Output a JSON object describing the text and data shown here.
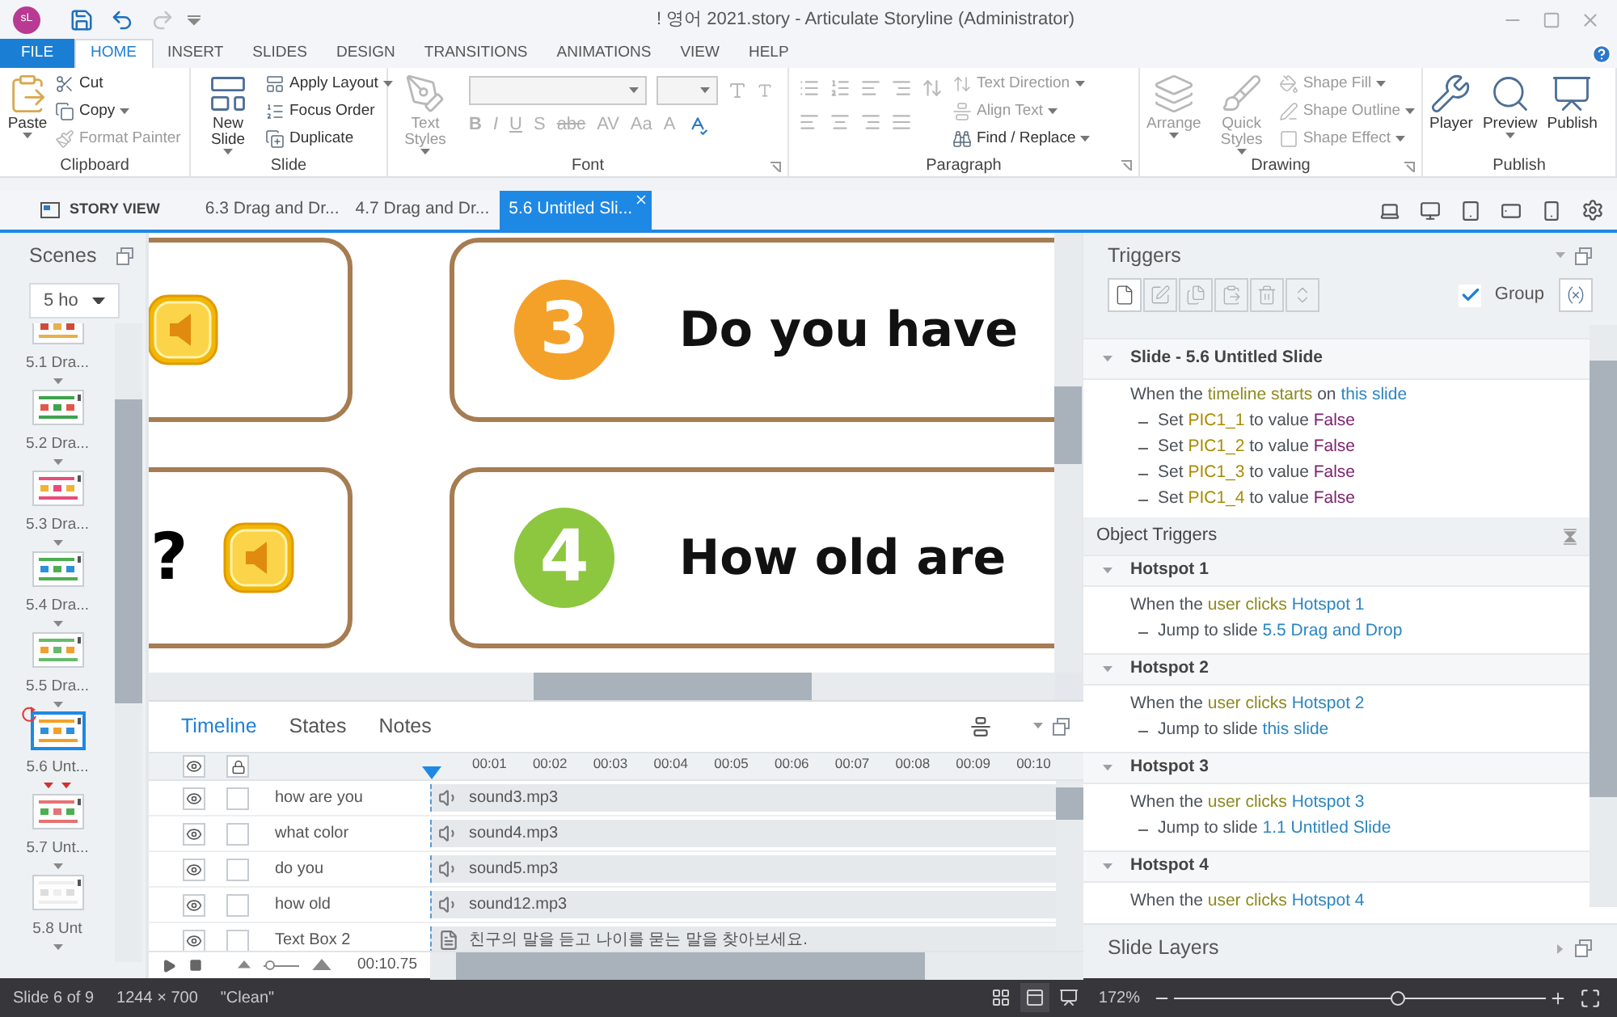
{
  "window": {
    "title": "! 영어 2021.story - Articulate Storyline (Administrator)",
    "app_badge": "sL"
  },
  "ribbon": {
    "tabs": [
      {
        "label": "FILE",
        "kind": "file",
        "selected": false
      },
      {
        "label": "HOME",
        "kind": "tab",
        "selected": true
      },
      {
        "label": "INSERT",
        "kind": "tab",
        "selected": false
      },
      {
        "label": "SLIDES",
        "kind": "tab",
        "selected": false
      },
      {
        "label": "DESIGN",
        "kind": "tab",
        "selected": false
      },
      {
        "label": "TRANSITIONS",
        "kind": "tab",
        "selected": false
      },
      {
        "label": "ANIMATIONS",
        "kind": "tab",
        "selected": false
      },
      {
        "label": "VIEW",
        "kind": "tab",
        "selected": false
      },
      {
        "label": "HELP",
        "kind": "tab",
        "selected": false
      }
    ],
    "groups": [
      {
        "kind": "clipboard",
        "label": "Clipboard",
        "launcher": false,
        "large": [
          {
            "label": "Paste",
            "dropdown": true,
            "disabled": false
          }
        ],
        "small": [
          {
            "label": "Cut",
            "dropdown": false,
            "disabled": false
          },
          {
            "label": "Copy",
            "dropdown": true,
            "disabled": false
          },
          {
            "label": "Format Painter",
            "dropdown": false,
            "disabled": true
          }
        ]
      },
      {
        "kind": "slide",
        "label": "Slide",
        "launcher": false,
        "large": [
          {
            "label": "New Slide",
            "dropdown": true,
            "disabled": false
          }
        ],
        "small": [
          {
            "label": "Apply Layout",
            "dropdown": true,
            "disabled": false
          },
          {
            "label": "Focus Order",
            "dropdown": false,
            "disabled": false
          },
          {
            "label": "Duplicate",
            "dropdown": false,
            "disabled": false
          }
        ]
      },
      {
        "kind": "font",
        "label": "Font",
        "launcher": true,
        "large": [
          {
            "label": "Text Styles",
            "dropdown": true,
            "disabled": true
          }
        ],
        "format_buttons": [
          "B",
          "I",
          "U",
          "S",
          "abc",
          "AV",
          "Aa",
          "A"
        ]
      },
      {
        "kind": "paragraph",
        "label": "Paragraph",
        "launcher": true,
        "small": [
          {
            "label": "Text Direction",
            "dropdown": true,
            "disabled": true
          },
          {
            "label": "Align Text",
            "dropdown": true,
            "disabled": true
          },
          {
            "label": "Find / Replace",
            "dropdown": true,
            "disabled": false
          }
        ]
      },
      {
        "kind": "drawing",
        "label": "Drawing",
        "launcher": true,
        "large": [
          {
            "label": "Arrange",
            "dropdown": true,
            "disabled": true
          },
          {
            "label": "Quick Styles",
            "dropdown": true,
            "disabled": true
          }
        ],
        "small": [
          {
            "label": "Shape Fill",
            "dropdown": true,
            "disabled": true
          },
          {
            "label": "Shape Outline",
            "dropdown": true,
            "disabled": true
          },
          {
            "label": "Shape Effect",
            "dropdown": true,
            "disabled": true
          }
        ]
      },
      {
        "kind": "publish",
        "label": "Publish",
        "launcher": false,
        "large": [
          {
            "label": "Player",
            "dropdown": false,
            "disabled": false
          },
          {
            "label": "Preview",
            "dropdown": true,
            "disabled": false
          },
          {
            "label": "Publish",
            "dropdown": false,
            "disabled": false
          }
        ]
      }
    ]
  },
  "story_tabs": [
    {
      "label": "STORY VIEW",
      "kind": "story",
      "selected": false
    },
    {
      "label": "6.3 Drag and Dr...",
      "kind": "slide",
      "selected": false
    },
    {
      "label": "4.7 Drag and Dr...",
      "kind": "slide",
      "selected": false
    },
    {
      "label": "5.6 Untitled Sli...",
      "kind": "slide",
      "selected": true
    }
  ],
  "scenes": {
    "title": "Scenes",
    "dropdown": "5 ho",
    "slides": [
      {
        "label": "5.1 Dra...",
        "selected": false,
        "flagged": false
      },
      {
        "label": "5.2 Dra...",
        "selected": false,
        "flagged": false
      },
      {
        "label": "5.3 Dra...",
        "selected": false,
        "flagged": false
      },
      {
        "label": "5.4 Dra...",
        "selected": false,
        "flagged": false
      },
      {
        "label": "5.5 Dra...",
        "selected": false,
        "flagged": false
      },
      {
        "label": "5.6 Unt...",
        "selected": true,
        "flagged": true
      },
      {
        "label": "5.7 Unt...",
        "selected": false,
        "flagged": false
      },
      {
        "label": "5.8 Unt",
        "selected": false,
        "flagged": false
      }
    ]
  },
  "slide": {
    "cards": [
      {
        "kind": "sound"
      },
      {
        "kind": "question",
        "text": "?"
      },
      {
        "kind": "numbered",
        "number": "3",
        "color": "#f4a12a",
        "text": "Do you have"
      },
      {
        "kind": "numbered",
        "number": "4",
        "color": "#8dc63f",
        "text": "How old are"
      }
    ]
  },
  "timeline": {
    "tabs": [
      {
        "label": "Timeline",
        "selected": true
      },
      {
        "label": "States",
        "selected": false
      },
      {
        "label": "Notes",
        "selected": false
      }
    ],
    "ruler": [
      "00:01",
      "00:02",
      "00:03",
      "00:04",
      "00:05",
      "00:06",
      "00:07",
      "00:08",
      "00:09",
      "00:10"
    ],
    "rows": [
      {
        "name": "how are you",
        "visible": true,
        "locked": false,
        "kind": "audio",
        "item": "sound3.mp3"
      },
      {
        "name": "what color",
        "visible": true,
        "locked": false,
        "kind": "audio",
        "item": "sound4.mp3"
      },
      {
        "name": "do you",
        "visible": true,
        "locked": false,
        "kind": "audio",
        "item": "sound5.mp3"
      },
      {
        "name": "how old",
        "visible": true,
        "locked": false,
        "kind": "audio",
        "item": "sound12.mp3"
      },
      {
        "name": "Text Box 2",
        "visible": true,
        "locked": false,
        "kind": "text",
        "item": "친구의 말을 듣고 나이를 묻는 말을 찾아보세요."
      }
    ],
    "duration": "00:10.75",
    "zoom": {
      "level": 0.2
    }
  },
  "triggers": {
    "title": "Triggers",
    "toolbar": [
      {
        "disabled": false
      },
      {
        "disabled": true
      },
      {
        "disabled": true
      },
      {
        "disabled": true
      },
      {
        "disabled": true
      },
      {
        "disabled": true
      }
    ],
    "group_option": {
      "label": "Group",
      "checked": true
    },
    "slide_triggers": [
      {
        "title": "Slide - 5.6 Untitled Slide",
        "expanded": true,
        "lines": [
          {
            "kind": "condition",
            "parts": [
              {
                "text": "When the",
                "kind": "plain"
              },
              {
                "text": "timeline starts",
                "kind": "event"
              },
              {
                "text": "on",
                "kind": "plain"
              },
              {
                "text": "this slide",
                "kind": "object"
              }
            ]
          },
          {
            "kind": "action",
            "parts": [
              {
                "text": "Set",
                "kind": "plain"
              },
              {
                "text": "PIC1_1",
                "kind": "variable"
              },
              {
                "text": "to value",
                "kind": "plain"
              },
              {
                "text": "False",
                "kind": "value"
              }
            ]
          },
          {
            "kind": "action",
            "parts": [
              {
                "text": "Set",
                "kind": "plain"
              },
              {
                "text": "PIC1_2",
                "kind": "variable"
              },
              {
                "text": "to value",
                "kind": "plain"
              },
              {
                "text": "False",
                "kind": "value"
              }
            ]
          },
          {
            "kind": "action",
            "parts": [
              {
                "text": "Set",
                "kind": "plain"
              },
              {
                "text": "PIC1_3",
                "kind": "variable"
              },
              {
                "text": "to value",
                "kind": "plain"
              },
              {
                "text": "False",
                "kind": "value"
              }
            ]
          },
          {
            "kind": "action",
            "parts": [
              {
                "text": "Set",
                "kind": "plain"
              },
              {
                "text": "PIC1_4",
                "kind": "variable"
              },
              {
                "text": "to value",
                "kind": "plain"
              },
              {
                "text": "False",
                "kind": "value"
              }
            ]
          }
        ]
      }
    ],
    "object_triggers": {
      "title": "Object Triggers",
      "groups": [
        {
          "title": "Hotspot 1",
          "expanded": true,
          "lines": [
            {
              "kind": "condition",
              "parts": [
                {
                  "text": "When the",
                  "kind": "plain"
                },
                {
                  "text": "user clicks",
                  "kind": "event"
                },
                {
                  "text": "Hotspot 1",
                  "kind": "object"
                }
              ]
            },
            {
              "kind": "action",
              "parts": [
                {
                  "text": "Jump to slide",
                  "kind": "plain"
                },
                {
                  "text": "5.5 Drag and Drop",
                  "kind": "object"
                }
              ]
            }
          ]
        },
        {
          "title": "Hotspot 2",
          "expanded": true,
          "lines": [
            {
              "kind": "condition",
              "parts": [
                {
                  "text": "When the",
                  "kind": "plain"
                },
                {
                  "text": "user clicks",
                  "kind": "event"
                },
                {
                  "text": "Hotspot 2",
                  "kind": "object"
                }
              ]
            },
            {
              "kind": "action",
              "parts": [
                {
                  "text": "Jump to slide",
                  "kind": "plain"
                },
                {
                  "text": "this slide",
                  "kind": "object"
                }
              ]
            }
          ]
        },
        {
          "title": "Hotspot 3",
          "expanded": true,
          "lines": [
            {
              "kind": "condition",
              "parts": [
                {
                  "text": "When the",
                  "kind": "plain"
                },
                {
                  "text": "user clicks",
                  "kind": "event"
                },
                {
                  "text": "Hotspot 3",
                  "kind": "object"
                }
              ]
            },
            {
              "kind": "action",
              "parts": [
                {
                  "text": "Jump to slide",
                  "kind": "plain"
                },
                {
                  "text": "1.1 Untitled Slide",
                  "kind": "object"
                }
              ]
            }
          ]
        },
        {
          "title": "Hotspot 4",
          "expanded": true,
          "lines": [
            {
              "kind": "condition",
              "parts": [
                {
                  "text": "When the",
                  "kind": "plain"
                },
                {
                  "text": "user clicks",
                  "kind": "event"
                },
                {
                  "text": "Hotspot 4",
                  "kind": "object"
                }
              ]
            }
          ]
        }
      ]
    },
    "layers_title": "Slide Layers"
  },
  "status_bar": {
    "slide": "Slide 6 of 9",
    "size": "1244 × 700",
    "theme": "\"Clean\"",
    "views": [
      {
        "kind": "grid",
        "selected": false
      },
      {
        "kind": "normal",
        "selected": true
      },
      {
        "kind": "presenter",
        "selected": false
      }
    ],
    "zoom": "172%",
    "zoom_slider": {
      "level": 0.6
    }
  }
}
